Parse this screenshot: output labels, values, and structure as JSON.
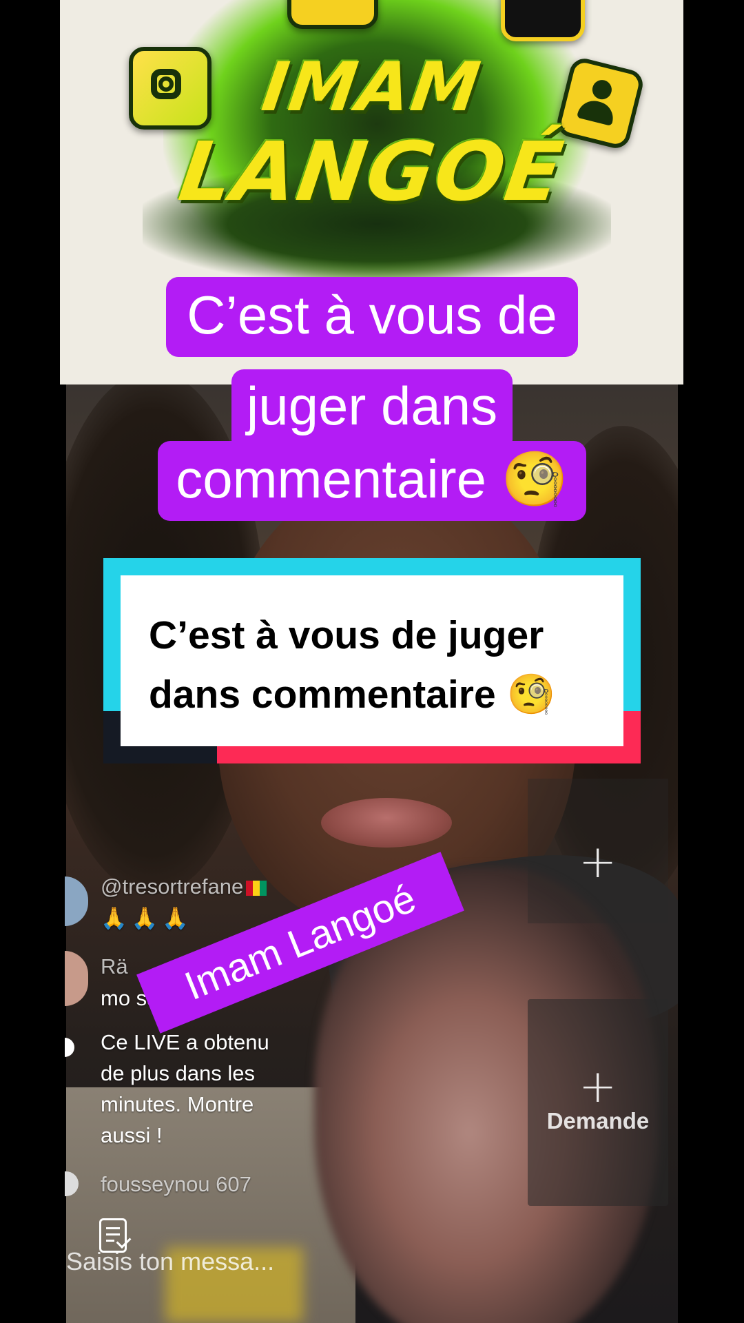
{
  "banner": {
    "logo_line1": "IMAM",
    "logo_line2": "LANGOÉ"
  },
  "caption_top": {
    "line1": "C’est à vous de",
    "line2": "juger dans",
    "line3": "commentaire 🧐"
  },
  "caption_box": {
    "line1": "C’est à vous de juger",
    "line2": "dans commentaire 🧐"
  },
  "watermark": "Imam Langoé",
  "live_chat": {
    "messages": [
      {
        "user": "@tresortrefane",
        "text": "🙏🙏🙏"
      },
      {
        "user": "Rä",
        "text": "mo     sammi"
      },
      {
        "user": "",
        "text": "Ce LIVE a obtenu",
        "text2": "de plus dans les",
        "text3": "minutes. Montre",
        "text4": "aussi !"
      },
      {
        "user": "fousseynou 607",
        "text": ""
      }
    ],
    "input_placeholder": "Saisis ton messa..."
  },
  "side_panel": {
    "request_label": "Demande"
  },
  "colors": {
    "caption_purple": "#b31cf5",
    "tiktok_cyan": "#25d3e9",
    "tiktok_pink": "#fd2a55",
    "logo_yellow": "#f7e61a"
  }
}
